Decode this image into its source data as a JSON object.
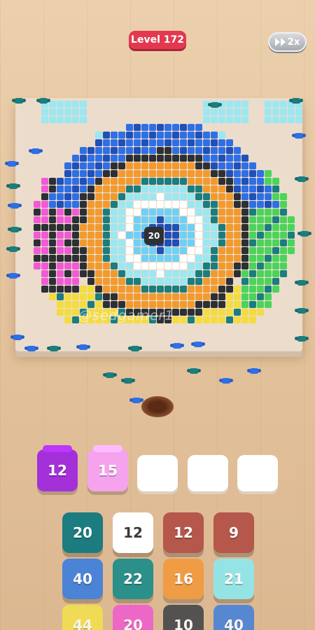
{
  "header": {
    "level": "Level 172",
    "speed": "2x",
    "speed_icon": "fast-forward-icon"
  },
  "board": {
    "center_value": "20",
    "watermark": "@sedgamer1"
  },
  "holding_slots": [
    {
      "value": "12",
      "color": "#a330d9",
      "filled": true
    },
    {
      "value": "15",
      "color": "#f4a3ec",
      "filled": true
    },
    {
      "value": "",
      "color": "#ffffff",
      "filled": false
    },
    {
      "value": "",
      "color": "#ffffff",
      "filled": false
    },
    {
      "value": "",
      "color": "#ffffff",
      "filled": false
    }
  ],
  "grid_rows": [
    [
      {
        "value": "20",
        "color": "#1c7c7f"
      },
      {
        "value": "12",
        "color": "#ffffff",
        "text_color": "#3a3a3a"
      },
      {
        "value": "12",
        "color": "#b5574a"
      },
      {
        "value": "9",
        "color": "#b5574a"
      }
    ],
    [
      {
        "value": "40",
        "color": "#3f7fdc"
      },
      {
        "value": "22",
        "color": "#1c8c8a"
      },
      {
        "value": "16",
        "color": "#f29a3e"
      },
      {
        "value": "21",
        "color": "#8fe8ec"
      }
    ],
    [
      {
        "value": "44",
        "color": "#f4e24a"
      },
      {
        "value": "20",
        "color": "#f05ad0"
      },
      {
        "value": "10",
        "color": "#3d4146"
      },
      {
        "value": "40",
        "color": "#3f7fdc"
      }
    ]
  ],
  "palette": {
    "cyan": "#9be7f2",
    "blue": "#2e6fe6",
    "navy": "#1f4fb8",
    "orange": "#f29a2e",
    "dark": "#2c3034",
    "teal": "#1b7d7e",
    "pink": "#f15ad6",
    "yellow": "#f4dc3e",
    "green": "#4ad45a",
    "brown": "#a5553f",
    "white": "#ffffff",
    "sky": "#6fd0f5"
  }
}
